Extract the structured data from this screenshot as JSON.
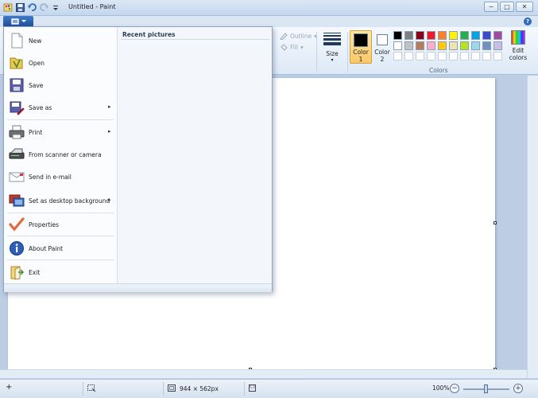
{
  "window": {
    "title": "Untitled - Paint",
    "minimize_glyph": "−",
    "maximize_glyph": "□",
    "close_glyph": "✕"
  },
  "ribbon": {
    "outline_label": "Outline",
    "fill_label": "Fill",
    "size_label": "Size",
    "color1_label": "Color\n1",
    "color2_label": "Color\n2",
    "colors_group_label": "Colors",
    "edit_colors_label": "Edit\ncolors",
    "help_glyph": "?",
    "color1": "#000000",
    "color2": "#ffffff",
    "palette_row1": [
      "#000000",
      "#7f7f7f",
      "#880015",
      "#ed1c24",
      "#ff7f27",
      "#fff200",
      "#22b14c",
      "#00a2e8",
      "#3f48cc",
      "#a349a4"
    ],
    "palette_row2": [
      "#ffffff",
      "#c3c3c3",
      "#b97a57",
      "#ffaec9",
      "#ffc90e",
      "#efe4b0",
      "#b5e61d",
      "#99d9ea",
      "#7092be",
      "#c8bfe7"
    ],
    "palette_row3": [
      "#ffffff",
      "#ffffff",
      "#ffffff",
      "#ffffff",
      "#ffffff",
      "#ffffff",
      "#ffffff",
      "#ffffff",
      "#ffffff",
      "#ffffff"
    ]
  },
  "app_menu": {
    "recent_title": "Recent pictures",
    "items": [
      {
        "label": "New",
        "icon": "new-document-icon",
        "submenu": false
      },
      {
        "label": "Open",
        "icon": "open-folder-icon",
        "submenu": false
      },
      {
        "label": "Save",
        "icon": "floppy-disk-icon",
        "submenu": false
      },
      {
        "label": "Save as",
        "icon": "save-as-icon",
        "submenu": true
      },
      {
        "label": "Print",
        "icon": "printer-icon",
        "submenu": true
      },
      {
        "label": "From scanner or camera",
        "icon": "scanner-icon",
        "submenu": false
      },
      {
        "label": "Send in e-mail",
        "icon": "email-icon",
        "submenu": false
      },
      {
        "label": "Set as desktop background",
        "icon": "desktop-background-icon",
        "submenu": true
      },
      {
        "label": "Properties",
        "icon": "checkmark-icon",
        "submenu": false
      },
      {
        "label": "About Paint",
        "icon": "info-icon",
        "submenu": false
      },
      {
        "label": "Exit",
        "icon": "exit-icon",
        "submenu": false
      }
    ],
    "submenu_arrow": "▸"
  },
  "statusbar": {
    "image_size": "944 × 562px",
    "zoom": "100%",
    "zoom_out_glyph": "−",
    "zoom_in_glyph": "+",
    "position_glyph": "+"
  }
}
